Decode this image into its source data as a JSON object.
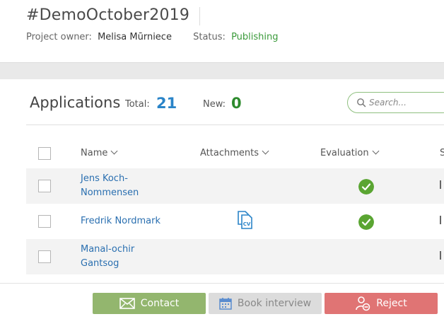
{
  "project": {
    "title": "#DemoOctober2019",
    "owner_label": "Project owner:",
    "owner_name": "Melisa Mūrniece",
    "status_label": "Status:",
    "status_value": "Publishing"
  },
  "applications": {
    "title": "Applications",
    "total_label": "Total:",
    "total_count": "21",
    "new_label": "New:",
    "new_count": "0",
    "search_placeholder": "Search..."
  },
  "table": {
    "columns": [
      {
        "label": "Name"
      },
      {
        "label": "Attachments"
      },
      {
        "label": "Evaluation"
      },
      {
        "label": "S"
      }
    ],
    "rows": [
      {
        "name": "Jens Koch-Nommensen",
        "has_cv": false,
        "evaluated": true,
        "status_truncated": "I"
      },
      {
        "name": "Fredrik Nordmark",
        "has_cv": true,
        "evaluated": true,
        "status_truncated": "I"
      },
      {
        "name": "Manal-ochir Gantsog",
        "has_cv": false,
        "evaluated": false,
        "status_truncated": "I"
      }
    ]
  },
  "actions": {
    "contact": "Contact",
    "book_interview": "Book interview",
    "reject": "Reject"
  },
  "colors": {
    "link": "#2a6fb0",
    "total": "#2a84c8",
    "new": "#2e8b2e",
    "status": "#3a9a3a",
    "contact_button": "#93b66e",
    "book_button": "#dcdcdc",
    "reject_button": "#e07474",
    "check_badge": "#5aa532"
  },
  "icons": [
    "search-icon",
    "envelope-icon",
    "calendar-icon",
    "remove-user-icon",
    "cv-file-icon",
    "check-circle-icon",
    "chevron-down-icon"
  ]
}
